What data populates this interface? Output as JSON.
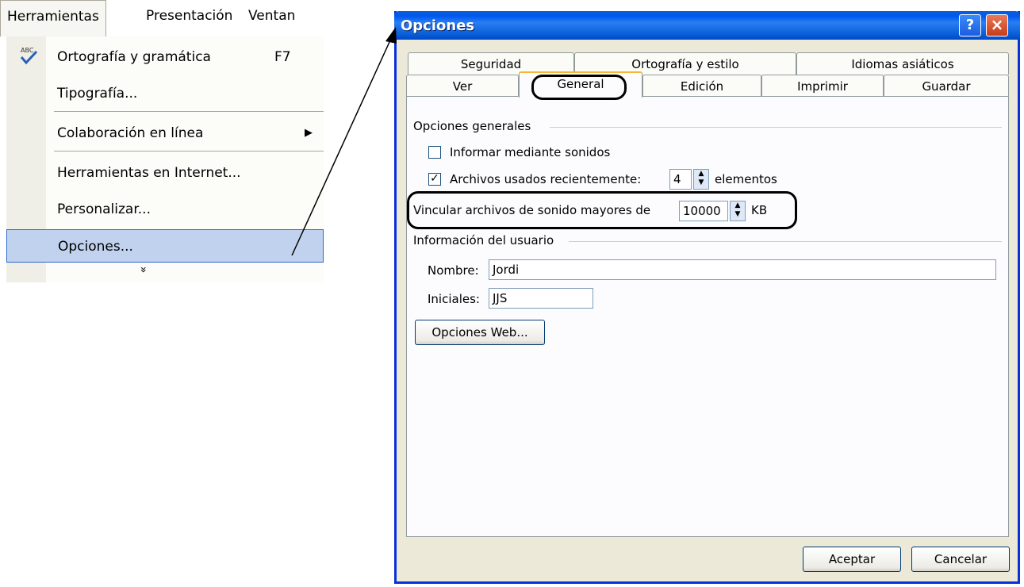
{
  "menu": {
    "menubar": [
      "Herramientas",
      "Presentación",
      "Ventan"
    ],
    "items": [
      {
        "label": "Ortografía y gramática",
        "shortcut": "F7"
      },
      {
        "label": "Tipografía..."
      },
      {
        "label": "Colaboración en línea"
      },
      {
        "label": "Herramientas en Internet..."
      },
      {
        "label": "Personalizar..."
      },
      {
        "label": "Opciones..."
      }
    ],
    "more": "»",
    "spell_icon_text": "ABC"
  },
  "dialog": {
    "title": "Opciones",
    "help": "?",
    "close": "×",
    "tabs_row1": [
      "Seguridad",
      "Ortografía y estilo",
      "Idiomas asiáticos"
    ],
    "tabs_row2": [
      "Ver",
      "General",
      "Edición",
      "Imprimir",
      "Guardar"
    ],
    "active_tab": "General",
    "general_group": "Opciones generales",
    "opt_sound": {
      "label": "Informar mediante sonidos",
      "checked": false
    },
    "opt_recent": {
      "label": "Archivos usados recientemente:",
      "checked": true,
      "value": "4",
      "unit": "elementos"
    },
    "opt_link": {
      "label": "Vincular archivos de sonido mayores de",
      "value": "10000",
      "unit": "KB"
    },
    "user_group": "Información del usuario",
    "name_label": "Nombre:",
    "name_value": "Jordi",
    "initials_label": "Iniciales:",
    "initials_value": "JJS",
    "web_button": "Opciones Web...",
    "ok": "Aceptar",
    "cancel": "Cancelar"
  }
}
